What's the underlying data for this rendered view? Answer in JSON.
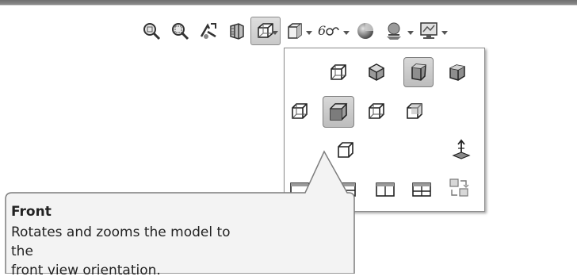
{
  "toolbar": {
    "items": [
      {
        "icon": "zoom-to-fit-icon"
      },
      {
        "icon": "zoom-to-area-icon"
      },
      {
        "icon": "previous-view-icon"
      },
      {
        "icon": "section-view-icon"
      },
      {
        "icon": "view-orientation-icon",
        "active": true,
        "has_dropdown": true
      },
      {
        "icon": "display-style-icon",
        "has_dropdown": true
      },
      {
        "icon": "hide-show-items-icon",
        "has_dropdown": true
      },
      {
        "icon": "edit-appearance-icon"
      },
      {
        "icon": "apply-scene-icon",
        "has_dropdown": true
      },
      {
        "icon": "view-settings-icon",
        "has_dropdown": true
      }
    ]
  },
  "view_menu": {
    "items": [
      {
        "icon": "top-view-icon"
      },
      {
        "icon": "isometric-view-icon"
      },
      {
        "icon": "trimetric-view-icon",
        "active": true
      },
      {
        "icon": "dimetric-view-icon"
      },
      {
        "icon": "left-view-icon"
      },
      {
        "icon": "front-view-icon",
        "active": true
      },
      {
        "icon": "right-view-icon"
      },
      {
        "icon": "back-view-icon"
      },
      {
        "icon": "bottom-view-icon"
      },
      {
        "icon": "normal-to-icon"
      },
      {
        "icon": "single-view-icon"
      },
      {
        "icon": "two-view-horizontal-icon"
      },
      {
        "icon": "two-view-vertical-icon"
      },
      {
        "icon": "four-view-icon"
      },
      {
        "icon": "link-views-icon"
      }
    ]
  },
  "tooltip": {
    "title": "Front",
    "description_line1": "Rotates and zooms the model to the",
    "description_line2": "front view orientation."
  },
  "colors": {
    "tooltip_bg": "#f2f2f2",
    "tooltip_border": "#7a7a7a",
    "active_bg": "#cdcdcd",
    "top_bar": "#7a7a7a"
  }
}
